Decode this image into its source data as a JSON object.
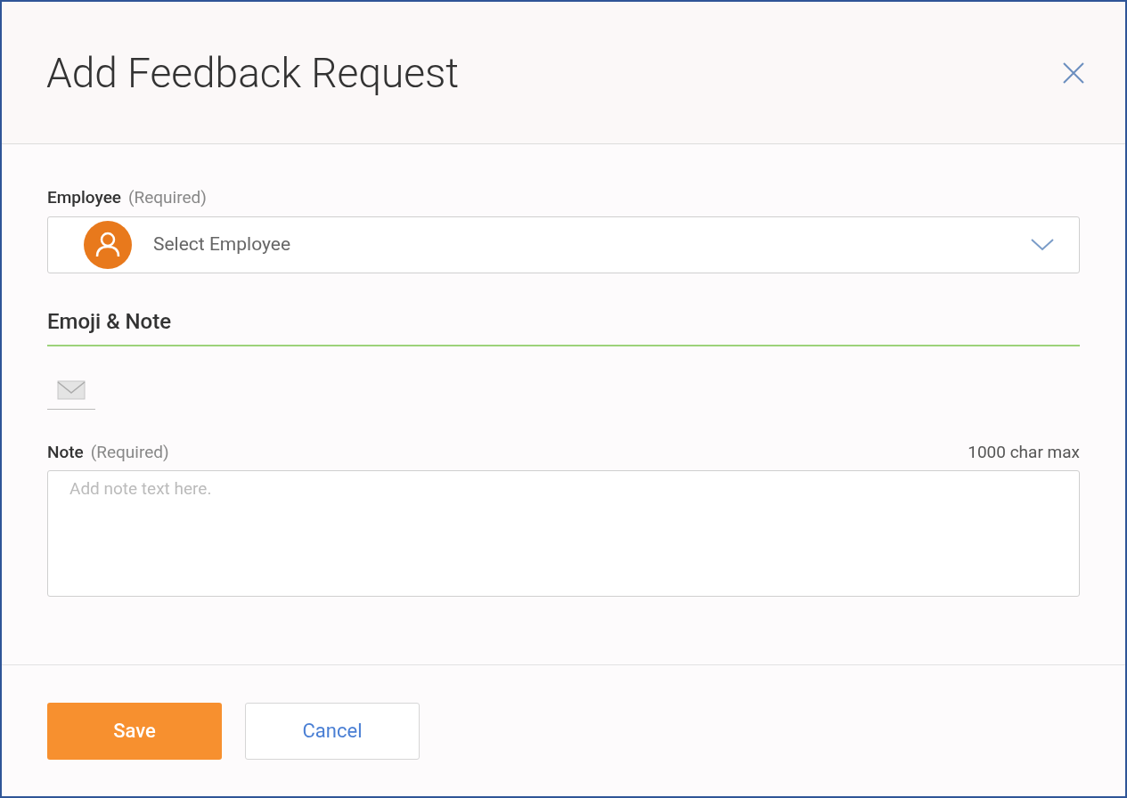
{
  "dialog": {
    "title": "Add Feedback Request"
  },
  "employee": {
    "label": "Employee",
    "required_note": "(Required)",
    "placeholder": "Select Employee"
  },
  "emoji_section": {
    "heading": "Emoji & Note"
  },
  "note": {
    "label": "Note",
    "required_note": "(Required)",
    "limit": "1000 char max",
    "placeholder": "Add note text here."
  },
  "buttons": [
    {
      "label": "Save",
      "kind": "primary"
    },
    {
      "label": "Cancel",
      "kind": "secondary"
    }
  ]
}
